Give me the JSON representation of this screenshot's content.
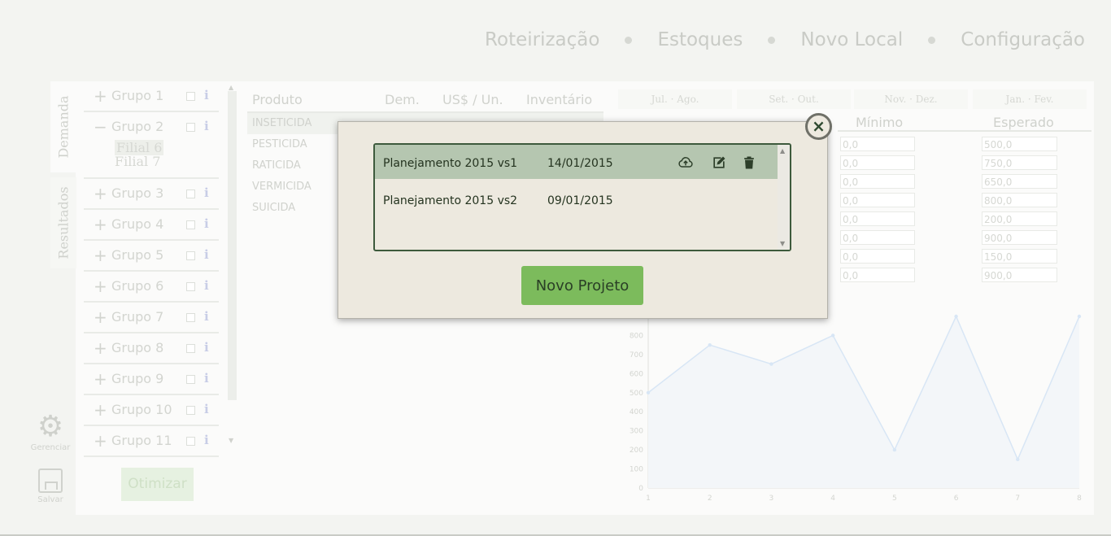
{
  "nav": {
    "items": [
      "Roteirização",
      "Estoques",
      "Novo Local",
      "Configuração"
    ]
  },
  "tabs": {
    "demanda": "Demanda",
    "resultados": "Resultados"
  },
  "groups": [
    {
      "label": "Grupo 1"
    },
    {
      "label": "Grupo 2",
      "expanded": true,
      "children": [
        "Filial 6",
        "Filial 7"
      ]
    },
    {
      "label": "Grupo 3"
    },
    {
      "label": "Grupo 4"
    },
    {
      "label": "Grupo 5"
    },
    {
      "label": "Grupo 6"
    },
    {
      "label": "Grupo 7"
    },
    {
      "label": "Grupo 8"
    },
    {
      "label": "Grupo 9"
    },
    {
      "label": "Grupo 10"
    },
    {
      "label": "Grupo 11"
    }
  ],
  "group_info_label": "i",
  "sidebar": {
    "gear_label": "Gerenciar",
    "save_label": "Salvar",
    "otimizar_label": "Otimizar"
  },
  "products": {
    "headers": [
      "Produto",
      "Dem.",
      "US$ / Un.",
      "Inventário"
    ],
    "rows": [
      "INSETICIDA",
      "PESTICIDA",
      "RATICIDA",
      "VERMICIDA",
      "SUICIDA"
    ]
  },
  "periods": [
    "Jul. · Ago.",
    "Set. · Out.",
    "Nov. · Dez.",
    "Jan. · Fev."
  ],
  "columns": {
    "minimo": "Mínimo",
    "esperado": "Esperado"
  },
  "inputs": {
    "minimo": [
      "0,0",
      "0,0",
      "0,0",
      "0,0",
      "0,0",
      "0,0",
      "0,0",
      "0,0"
    ],
    "esperado": [
      "500,0",
      "750,0",
      "650,0",
      "800,0",
      "200,0",
      "900,0",
      "150,0",
      "900,0"
    ]
  },
  "chart_data": {
    "type": "area",
    "x": [
      1,
      2,
      3,
      4,
      5,
      6,
      7,
      8
    ],
    "values": [
      500,
      750,
      650,
      800,
      200,
      900,
      150,
      900
    ],
    "y_ticks": [
      0,
      100,
      200,
      300,
      400,
      500,
      600,
      700,
      800
    ],
    "ylim": [
      0,
      900
    ],
    "colors": {
      "line": "#d8e6f5",
      "fill": "#f3f6f9"
    }
  },
  "modal": {
    "projects": [
      {
        "name": "Planejamento 2015 vs1",
        "date": "14/01/2015",
        "selected": true
      },
      {
        "name": "Planejamento 2015 vs2",
        "date": "09/01/2015",
        "selected": false
      }
    ],
    "new_project_label": "Novo Projeto",
    "close_symbol": "×",
    "colors": {
      "button": "#7cbb5c",
      "selected_row": "#b5c6b0",
      "border": "#3d5a3c"
    }
  }
}
